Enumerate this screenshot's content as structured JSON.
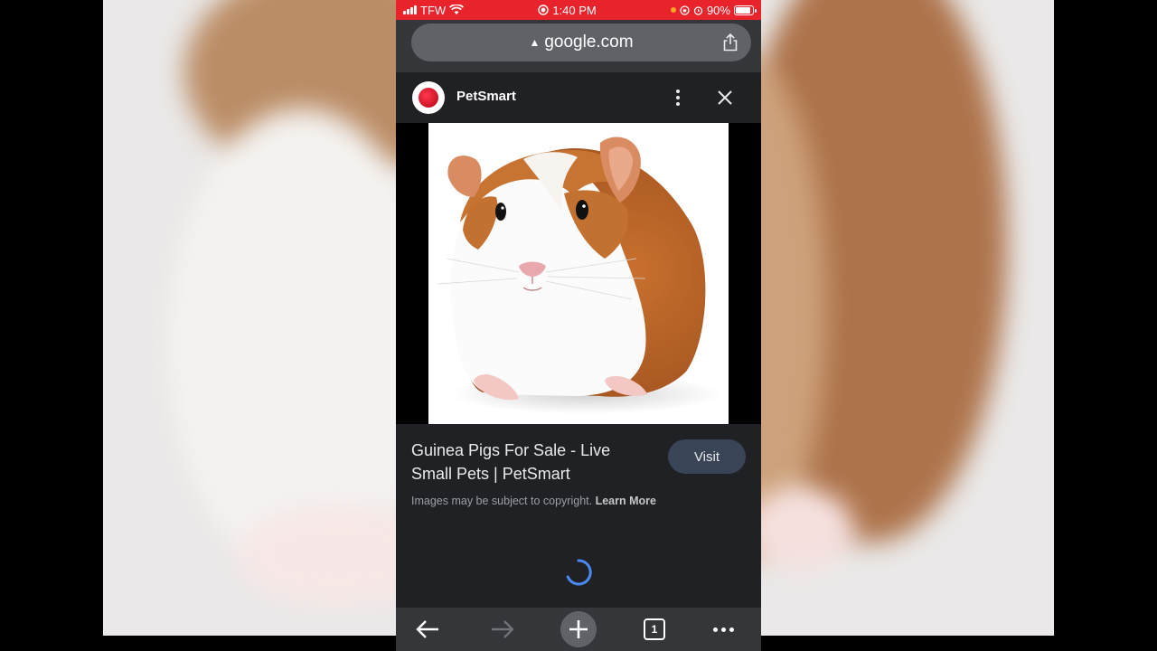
{
  "status_bar": {
    "carrier": "TFW",
    "time": "1:40 PM",
    "battery": "90%",
    "battery_level": 0.9
  },
  "url_bar": {
    "url": "google.com",
    "security_icon": "warning-triangle-icon",
    "share_icon": "share-icon"
  },
  "source": {
    "name": "PetSmart",
    "logo_icon": "petsmart-logo",
    "menu_icon": "more-vert-icon",
    "close_icon": "close-icon"
  },
  "result": {
    "title": "Guinea Pigs For Sale - Live Small Pets | PetSmart",
    "visit_label": "Visit",
    "copyright_text": "Images may be subject to copyright.",
    "learn_more": "Learn More"
  },
  "toolbar": {
    "back_icon": "arrow-left-icon",
    "forward_icon": "arrow-right-icon",
    "new_tab_icon": "plus-icon",
    "tab_count": "1",
    "more_icon": "more-horiz-icon"
  },
  "colors": {
    "status_bar": "#e8232b",
    "browser_chrome": "#35363a",
    "panel_bg": "#202124",
    "visit_button": "#394457",
    "spinner": "#4a8af4"
  }
}
